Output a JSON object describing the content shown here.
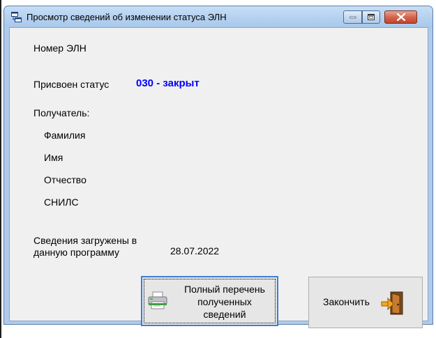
{
  "window": {
    "title": "Просмотр сведений об изменении статуса ЭЛН"
  },
  "fields": {
    "eln_number_label": "Номер ЭЛН",
    "status_label": "Присвоен статус",
    "status_value": "030 - закрыт",
    "recipient_label": "Получатель:",
    "surname_label": "Фамилия",
    "name_label": "Имя",
    "patronymic_label": "Отчество",
    "snils_label": "СНИЛС",
    "loaded_label_line1": "Сведения загружены в",
    "loaded_label_line2": "данную программу",
    "loaded_date": "28.07.2022"
  },
  "buttons": {
    "full_list_line1": "Полный перечень",
    "full_list_line2": "полученных",
    "full_list_line3": "сведений",
    "finish": "Закончить"
  },
  "colors": {
    "status_value": "#0000ff",
    "title_bar": "#b3d0ef",
    "close_button": "#c9513b"
  },
  "icons": {
    "app": "window-app-icon",
    "full_list": "printer-icon",
    "finish": "exit-door-icon"
  }
}
